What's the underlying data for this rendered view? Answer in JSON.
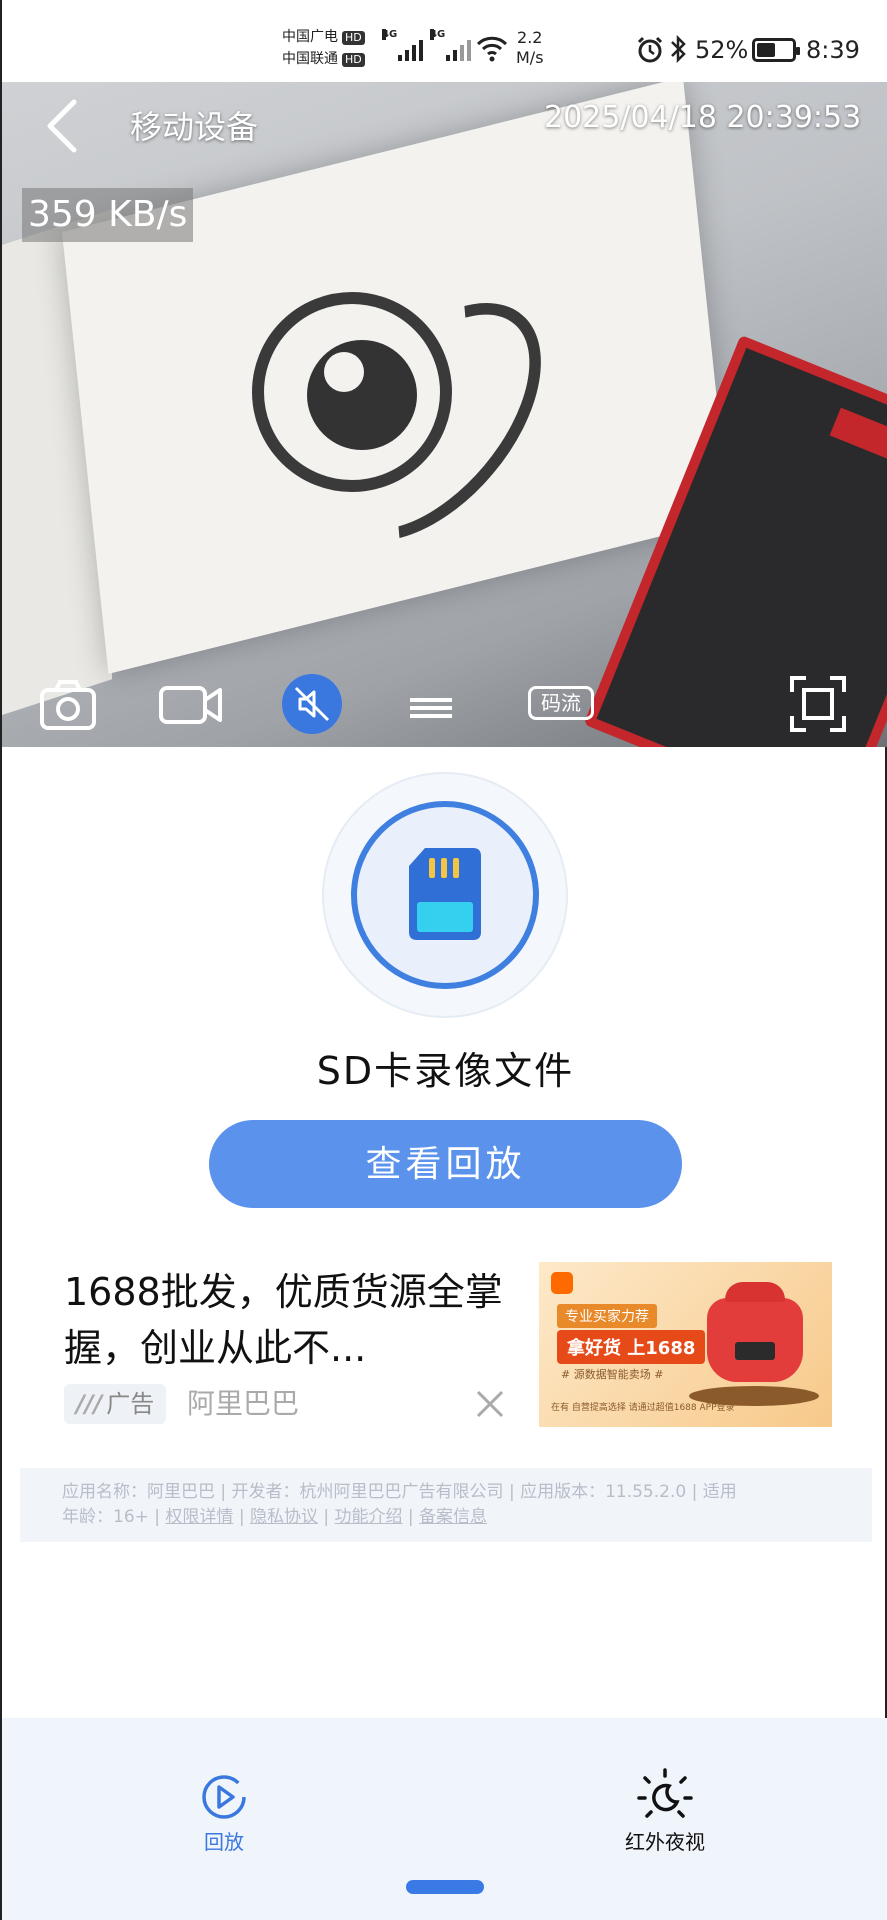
{
  "status_bar": {
    "carrier_1": "中国广电",
    "carrier_2": "中国联通",
    "hd_badge": "HD",
    "net_type": "4G",
    "net_speed_value": "2.2",
    "net_speed_unit": "M/s",
    "battery_percent": "52%",
    "battery_level": 0.52,
    "time": "8:39"
  },
  "video": {
    "title": "移动设备",
    "timestamp": "2025/04/18 20:39:53",
    "bitrate": "359 KB/s",
    "stream_button_label": "码流",
    "controls": [
      "camera-icon",
      "video-record-icon",
      "mute-icon",
      "stack-icon",
      "stream-button",
      "fullscreen-icon"
    ]
  },
  "playback_section": {
    "icon": "sd-card-icon",
    "title": "SD卡录像文件",
    "button_label": "查看回放"
  },
  "ad": {
    "headline": "1688批发，优质货源全掌握，创业从此不...",
    "tag_label": "广告",
    "source": "阿里巴巴",
    "image_text_1": "专业买家力荐",
    "image_text_2": "拿好货 上1688",
    "image_text_3": "# 源数据智能卖场 #",
    "image_text_4": "在有 自营提高选择 请通过超值1688 APP登录"
  },
  "app_info": {
    "line1": "应用名称：阿里巴巴 | 开发者：杭州阿里巴巴广告有限公司 | 应用版本：11.55.2.0 | 适用",
    "line2_prefix": "年龄：16+ | ",
    "link_permissions": "权限详情",
    "link_privacy": "隐私协议",
    "link_features": "功能介绍",
    "link_filing": "备案信息"
  },
  "bottom_nav": {
    "items": [
      {
        "label": "回放",
        "icon": "playback-icon",
        "color": "#3a78e0"
      },
      {
        "label": "红外夜视",
        "icon": "night-vision-icon",
        "color": "#111111"
      }
    ]
  },
  "colors": {
    "accent": "#3a78e0",
    "button": "#5b93ec",
    "nav_bg": "#f0f4fb"
  }
}
